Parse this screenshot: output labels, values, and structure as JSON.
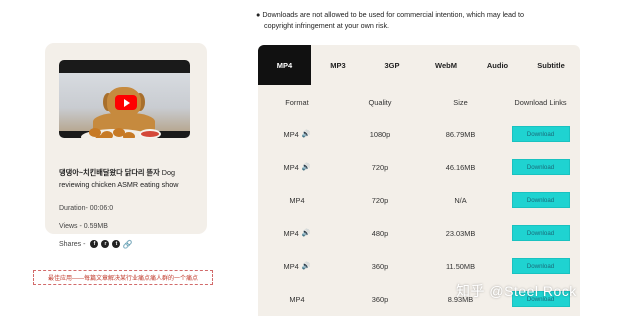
{
  "notice": {
    "line1": "Downloads are not allowed to be used for commercial intention, which may lead to",
    "line2": "copyright infringement at your own risk."
  },
  "video": {
    "title_bold": "댕댕아~치킨배달왔다 닭다리 뜯자",
    "title_rest": " Dog reviewing chicken ASMR eating show",
    "duration": "Duration-  00:06:0",
    "views": "Views - 0.59MB"
  },
  "shares": {
    "label": "Shares -",
    "icons": [
      "facebook-icon",
      "reddit-icon",
      "twitter-icon",
      "link-icon"
    ]
  },
  "ad_text": "最佳应用——每篇文章解决某行业痛点痛人群的一个痛点",
  "tabs": [
    "MP4",
    "MP3",
    "3GP",
    "WebM",
    "Audio",
    "Subtitle"
  ],
  "active_tab": "MP4",
  "table": {
    "headers": [
      "Format",
      "Quality",
      "Size",
      "Download Links"
    ],
    "rows": [
      {
        "format": "MP4",
        "speaker": true,
        "quality": "1080p",
        "size": "86.79MB",
        "action": "Download"
      },
      {
        "format": "MP4",
        "speaker": true,
        "quality": "720p",
        "size": "46.16MB",
        "action": "Download"
      },
      {
        "format": "MP4",
        "speaker": false,
        "quality": "720p",
        "size": "N/A",
        "action": "Download"
      },
      {
        "format": "MP4",
        "speaker": true,
        "quality": "480p",
        "size": "23.03MB",
        "action": "Download"
      },
      {
        "format": "MP4",
        "speaker": true,
        "quality": "360p",
        "size": "11.50MB",
        "action": "Download"
      },
      {
        "format": "MP4",
        "speaker": false,
        "quality": "360p",
        "size": "8.93MB",
        "action": "Download"
      }
    ]
  },
  "watermark": "知乎 @Steel Rock",
  "colors": {
    "tab_active_bg": "#111111",
    "panel_bg": "#f3efe9",
    "download_button": "#1fd3d1",
    "play_button": "#ff0000"
  }
}
